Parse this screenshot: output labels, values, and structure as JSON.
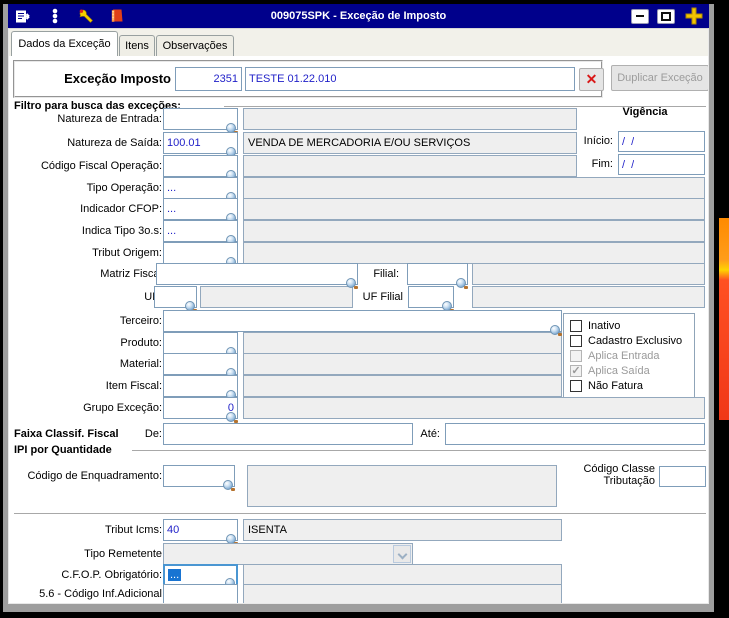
{
  "titlebar": {
    "title": "009075SPK - Exceção de Imposto"
  },
  "tabs": {
    "dados": "Dados da Exceção",
    "itens": "Itens",
    "observacoes": "Observações"
  },
  "header": {
    "label": "Exceção Imposto",
    "code": "2351",
    "description": "TESTE 01.22.010",
    "clear_glyph": "✕",
    "duplicate_label": "Duplicar Exceção"
  },
  "filter": {
    "heading": "Filtro para busca das exceções:",
    "natureza_entrada": {
      "label": "Natureza de Entrada:",
      "value": "",
      "desc": ""
    },
    "natureza_saida": {
      "label": "Natureza de Saída:",
      "value": "100.01",
      "desc": "VENDA DE MERCADORIA E/OU SERVIÇOS"
    },
    "codigo_fiscal_operacao": {
      "label": "Código Fiscal Operação:",
      "value": "",
      "desc": ""
    },
    "tipo_operacao": {
      "label": "Tipo Operação:",
      "value": "...",
      "desc": ""
    },
    "indicador_cfop": {
      "label": "Indicador CFOP:",
      "value": "...",
      "desc": ""
    },
    "indica_tipo_3os": {
      "label": "Indica Tipo 3o.s:",
      "value": "...",
      "desc": ""
    },
    "tribut_origem": {
      "label": "Tribut Origem:",
      "value": "",
      "desc": ""
    },
    "matriz_fiscal": {
      "label": "Matriz Fiscal",
      "value": ""
    },
    "filial": {
      "label": "Filial:",
      "value": "",
      "desc": ""
    },
    "uf": {
      "label": "UF:",
      "value": "",
      "desc": ""
    },
    "uf_filial": {
      "label": "UF Filial",
      "value": "",
      "desc": ""
    },
    "terceiro": {
      "label": "Terceiro:",
      "value": ""
    },
    "produto": {
      "label": "Produto:",
      "value": "",
      "desc": ""
    },
    "material": {
      "label": "Material:",
      "value": "",
      "desc": ""
    },
    "item_fiscal": {
      "label": "Item Fiscal:",
      "value": "",
      "desc": ""
    },
    "grupo_excecao": {
      "label": "Grupo Exceção:",
      "value": "0",
      "desc": ""
    }
  },
  "vigencia": {
    "heading": "Vigência",
    "inicio_label": "Início:",
    "inicio_value": "/  /",
    "fim_label": "Fim:",
    "fim_value": "/  /"
  },
  "flags": {
    "inativo": {
      "label": "Inativo",
      "checked": false,
      "enabled": true
    },
    "cadastro_exclusivo": {
      "label": "Cadastro Exclusivo",
      "checked": false,
      "enabled": true
    },
    "aplica_entrada": {
      "label": "Aplica Entrada",
      "checked": false,
      "enabled": false
    },
    "aplica_saida": {
      "label": "Aplica Saída",
      "checked": true,
      "enabled": false
    },
    "nao_fatura": {
      "label": "Não Fatura",
      "checked": false,
      "enabled": true
    }
  },
  "faixa": {
    "heading": "Faixa Classif. Fiscal",
    "de_label": "De:",
    "de_value": "",
    "ate_label": "Até:",
    "ate_value": ""
  },
  "ipi": {
    "heading": "IPI por Quantidade",
    "enquadramento_label": "Código de Enquadramento:",
    "enquadramento_value": "",
    "enquadramento_desc": "",
    "classe_label_line1": "Código Classe",
    "classe_label_line2": "Tributação",
    "classe_value": ""
  },
  "tributacao": {
    "tribut_icms": {
      "label": "Tribut Icms:",
      "value": "40",
      "desc": "ISENTA"
    },
    "tipo_remetente": {
      "label": "Tipo Remetente",
      "value": ""
    },
    "cfop_obrigatorio": {
      "label": "C.F.O.P. Obrigatório:",
      "value": "...",
      "desc": ""
    },
    "codigo_inf_adicional": {
      "label": "5.6 - Código Inf.Adicional",
      "value": "",
      "desc": ""
    }
  },
  "colors": {
    "titlebar": "#00008b",
    "value_text": "#1f1fc8",
    "field_border": "#7f9db9",
    "disabled_field": "#efefef",
    "clear_x": "#d91818",
    "accent_plus": "#f2c400",
    "strip_orange": "#ff8a00",
    "strip_red": "#f03818"
  }
}
